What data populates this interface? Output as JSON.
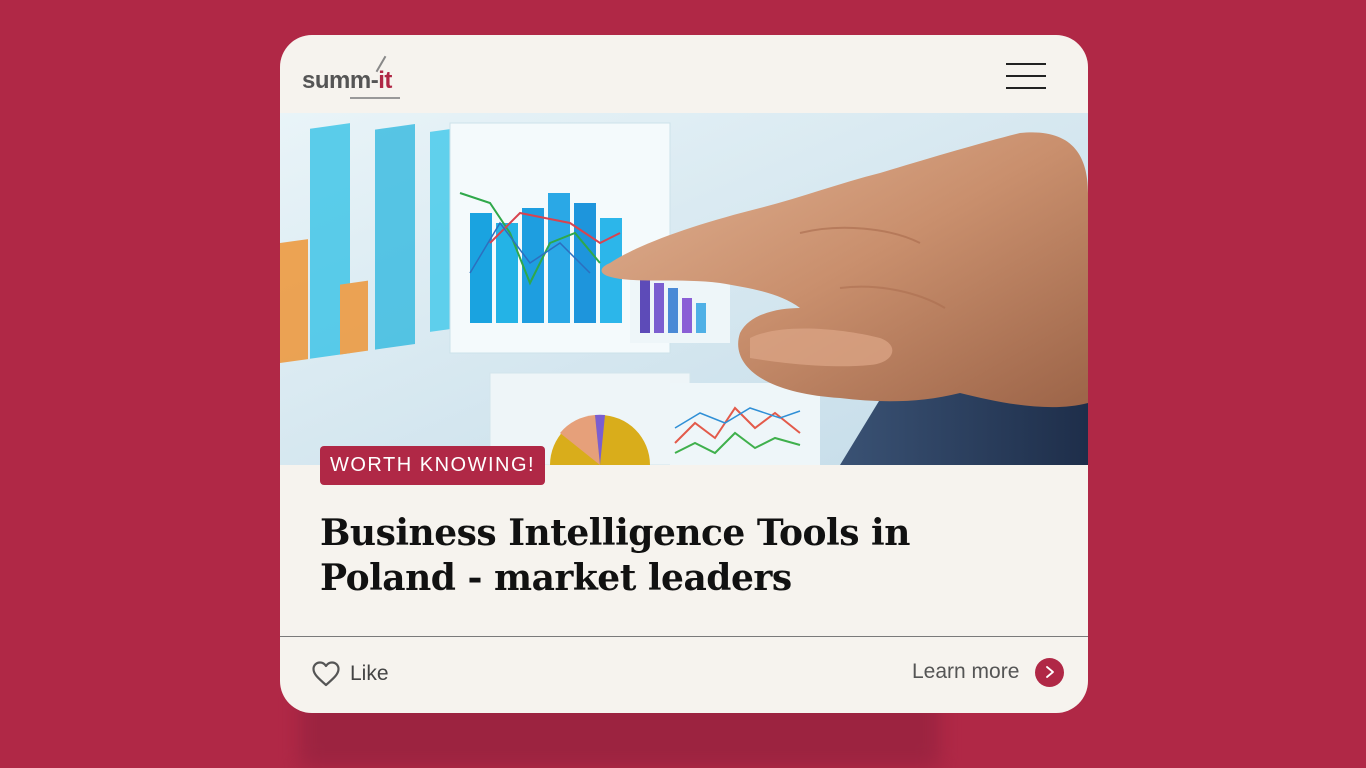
{
  "page": {
    "background_color": "#b02846",
    "card_color": "#f6f3ee"
  },
  "header": {
    "logo": {
      "text_main": "summ-",
      "text_accent": "it"
    },
    "menu_icon": "hamburger-menu-icon"
  },
  "hero": {
    "image_subject": "hand pointing at business charts on screen"
  },
  "article": {
    "tag": "WORTH KNOWING!",
    "title": "Business Intelligence Tools in Poland - market leaders"
  },
  "footer": {
    "like_label": "Like",
    "like_icon": "heart-outline-icon",
    "learn_more_label": "Learn more",
    "learn_more_icon": "chevron-right-icon",
    "accent_color": "#b02846"
  }
}
